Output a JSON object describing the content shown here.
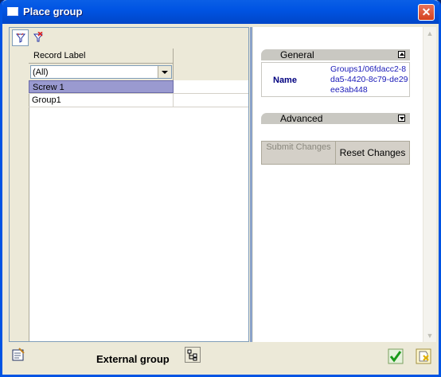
{
  "window": {
    "title": "Place group"
  },
  "grid": {
    "column_header": "Record Label",
    "filter_value": "(All)",
    "rows": [
      {
        "label": "Screw 1",
        "selected": true
      },
      {
        "label": "Group1",
        "selected": false
      }
    ]
  },
  "properties": {
    "general_header": "General",
    "name_label": "Name",
    "name_value": "Groups1/06fdacc2-8da5-4420-8c79-de29ee3ab448",
    "advanced_header": "Advanced",
    "submit_label": "Submit Changes",
    "reset_label": "Reset Changes"
  },
  "footer": {
    "external_group_label": "External group"
  },
  "icons": {
    "close": "close-icon",
    "filter_on": "filter-icon",
    "filter_clear": "filter-clear-icon",
    "properties": "properties-icon",
    "external_group": "tree-icon",
    "ok": "checkmark-icon",
    "cancel": "cancel-icon"
  },
  "colors": {
    "titlebar": "#0054e3",
    "selected_row": "#9a9ad0",
    "link_text": "#1a1ab8"
  }
}
